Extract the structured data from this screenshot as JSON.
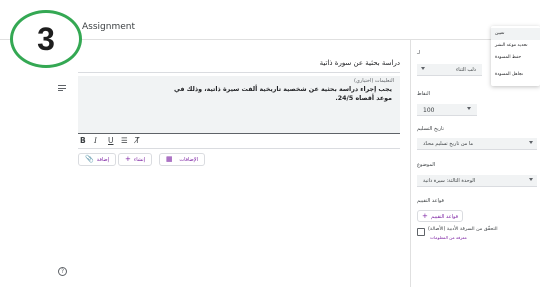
{
  "step_badge": "3",
  "title": "Assignment",
  "assignment_title": "دراسة بحثية عن سورة ذاتية",
  "instructions": {
    "label": "التعليمات (اختياري)",
    "text": "يجب إجراء دراسة بحثية عن شخصية تاريخية ألفت سيرة ذاتية، وذلك في موعد أقصاه 24/5."
  },
  "format_toolbar": {
    "bold": "B",
    "italic": "I",
    "underline": "U",
    "list": "☰",
    "clear": "T̸"
  },
  "attach": [
    {
      "label": "إضافة",
      "icon": "📎"
    },
    {
      "label": "إنشاء",
      "icon": "+"
    },
    {
      "label": "الإضافات",
      "icon": "▦"
    }
  ],
  "help_icon": "?",
  "right_panel": {
    "for_label": "لـ",
    "class_value": "ذلب الثناء",
    "points_label": "النقاط",
    "points_value": "100",
    "due_label": "تاريخ التسليم",
    "due_value": "ما من تاريخ تسليم محدّد",
    "topic_label": "الموضوع",
    "topic_value": "الوحدة الثالثة: سيرة ذاتية",
    "rubric_label": "قواعد التقييم",
    "rubric_button": "قواعد التقييم",
    "originality_label": "التحقّق من السرقة الأدبية (الأصالة)",
    "originality_sub": "معرفة من المعلومات"
  },
  "assign_menu": {
    "items": [
      "تعيين",
      "تحديد موعد النشر",
      "حفظ المسودة",
      "تجاهل المسودة"
    ]
  },
  "colors": {
    "accent": "#7b1fa2",
    "badge_border": "#34a853"
  }
}
